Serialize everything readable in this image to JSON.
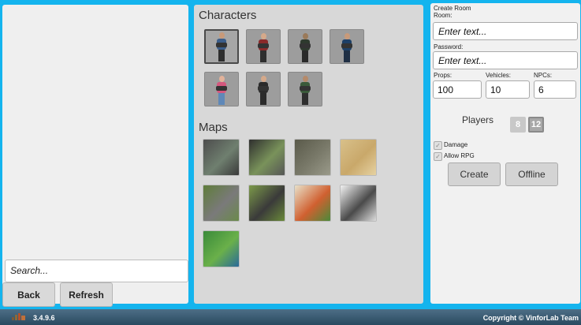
{
  "left": {
    "search_placeholder": "Search...",
    "back_label": "Back",
    "refresh_label": "Refresh"
  },
  "center": {
    "characters_title": "Characters",
    "characters": [
      {
        "name": "char-1",
        "shirt": "#3b5d8a",
        "legs": "#2e2e2e",
        "skin": "#c89a7a",
        "selected": true
      },
      {
        "name": "char-2",
        "shirt": "#8a2a2a",
        "legs": "#2e2e2e",
        "skin": "#d5a98a"
      },
      {
        "name": "char-3",
        "shirt": "#2e3a2e",
        "legs": "#2a2a2a",
        "skin": "#9a7a5a"
      },
      {
        "name": "char-4",
        "shirt": "#1d3f66",
        "legs": "#1f2f44",
        "skin": "#c89a7a"
      },
      {
        "name": "char-5",
        "shirt": "#d4587e",
        "legs": "#5f88b8",
        "skin": "#e2b29a"
      },
      {
        "name": "char-6",
        "shirt": "#2b2b2b",
        "legs": "#2b2b2b",
        "skin": "#d5a98a"
      },
      {
        "name": "char-7",
        "shirt": "#3a5a3a",
        "legs": "#2e2e2e",
        "skin": "#b58a6a"
      }
    ],
    "maps_title": "Maps",
    "maps": [
      {
        "name": "map-city-1",
        "colors": [
          "#4d4d4d",
          "#6f7f6f",
          "#3a3a3a"
        ]
      },
      {
        "name": "map-city-2",
        "colors": [
          "#2f2f2f",
          "#79925a",
          "#565656"
        ]
      },
      {
        "name": "map-city-3",
        "colors": [
          "#5a5a4a",
          "#7a7a6a",
          "#9a9a8a"
        ]
      },
      {
        "name": "map-desert",
        "colors": [
          "#d8c08a",
          "#c9a86a",
          "#e6d2a2"
        ]
      },
      {
        "name": "map-green-field",
        "colors": [
          "#5f7d3a",
          "#7a7a7a",
          "#6a8a4a"
        ]
      },
      {
        "name": "map-roads",
        "colors": [
          "#7c9a4a",
          "#3a3a3a",
          "#6a8a3a"
        ]
      },
      {
        "name": "map-town",
        "colors": [
          "#e8e0c8",
          "#d06030",
          "#4a8a3a"
        ]
      },
      {
        "name": "map-flat",
        "colors": [
          "#f2f2f2",
          "#4a4a4a",
          "#dcdcdc"
        ]
      },
      {
        "name": "map-green-town",
        "colors": [
          "#3a8a3a",
          "#6ab04a",
          "#2a6a9a"
        ]
      }
    ]
  },
  "right": {
    "header": "Create Room",
    "room_label": "Room:",
    "room_placeholder": "Enter text...",
    "password_label": "Password:",
    "password_placeholder": "Enter text...",
    "props_label": "Props:",
    "props_value": "100",
    "vehicles_label": "Vehicles:",
    "vehicles_value": "10",
    "npcs_label": "NPCs:",
    "npcs_value": "6",
    "players_label": "Players",
    "players_options": [
      "8",
      "12"
    ],
    "damage_label": "Damage",
    "allow_rpg_label": "Allow RPG",
    "create_label": "Create",
    "offline_label": "Offline"
  },
  "footer": {
    "version": "3.4.9.6",
    "copyright": "Copyright © VinforLab Team"
  }
}
